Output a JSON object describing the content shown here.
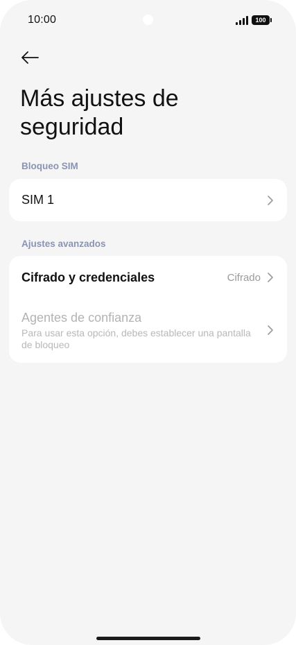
{
  "status_bar": {
    "time": "10:00",
    "battery": "100",
    "icons": [
      "signal-icon",
      "battery-icon"
    ]
  },
  "header": {
    "back_icon": "back-arrow-icon",
    "title": "Más ajustes de seguridad"
  },
  "sections": {
    "sim_lock": {
      "header": "Bloqueo SIM",
      "items": [
        {
          "title": "SIM 1",
          "icon": "chevron-right-icon"
        }
      ]
    },
    "advanced": {
      "header": "Ajustes avanzados",
      "items": [
        {
          "title": "Cifrado y credenciales",
          "value": "Cifrado",
          "icon": "chevron-right-icon"
        },
        {
          "title": "Agentes de confianza",
          "subtitle": "Para usar esta opción, debes establecer una pantalla de bloqueo",
          "disabled": true,
          "icon": "chevron-right-icon"
        }
      ]
    }
  },
  "colors": {
    "background": "#f5f5f5",
    "card": "#ffffff",
    "section_header": "#8a93b4",
    "text_primary": "#111111",
    "text_disabled": "#b3b3b3",
    "chevron": "#9a9a9a"
  }
}
